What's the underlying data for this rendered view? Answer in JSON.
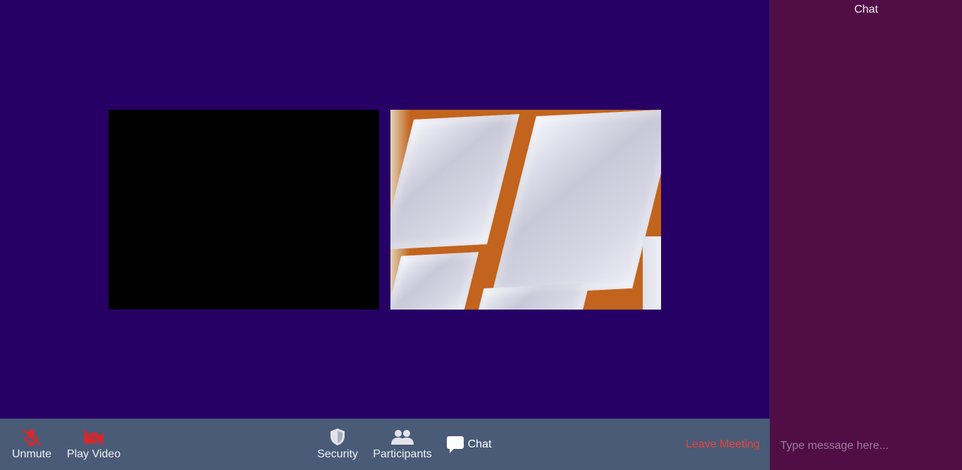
{
  "toolbar": {
    "unmute": {
      "label": "Unmute",
      "icon": "mic-muted-icon"
    },
    "play_video": {
      "label": "Play Video",
      "icon": "video-off-icon"
    },
    "security": {
      "label": "Security",
      "icon": "shield-icon"
    },
    "participants": {
      "label": "Participants",
      "icon": "people-icon"
    },
    "chat": {
      "label": "Chat",
      "icon": "chat-bubble-icon"
    },
    "leave": {
      "label": "Leave Meeting"
    }
  },
  "chat_panel": {
    "title": "Chat",
    "input_placeholder": "Type message here..."
  },
  "colors": {
    "stage_bg": "#270066",
    "toolbar_bg": "#4a5b77",
    "chat_bg": "#500d46",
    "muted_red": "#d9262a",
    "leave_red": "#e8443a"
  }
}
